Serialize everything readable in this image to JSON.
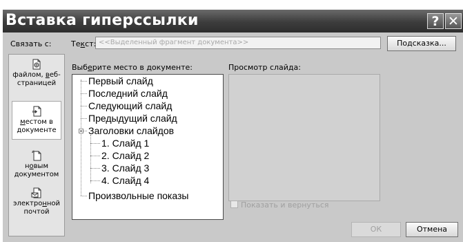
{
  "dialog": {
    "title": "Вставка гиперссылки",
    "help_glyph": "?",
    "close_glyph": "✕",
    "link_to_label": "Связать с:",
    "text_label_prefix": "Те",
    "text_label_accel": "к",
    "text_label_suffix": "ст:",
    "text_value": "<<Выделенный фрагмент документа>>",
    "tooltip_button_prefix": "По",
    "tooltip_button_accel": "д",
    "tooltip_button_suffix": "сказка...",
    "place_label_prefix": "Выб",
    "place_label_accel": "е",
    "place_label_suffix": "рите место в документе:",
    "preview_label": "Просмотр слайда:",
    "show_and_return_label": "Показать и вернуться",
    "ok_label": "ОК",
    "cancel_label": "Отмена"
  },
  "nav": [
    {
      "line1": "файлом, ",
      "accel": "в",
      "line1_rest": "еб-",
      "line2": "страницей",
      "icon": "existing-file-icon",
      "selected": false
    },
    {
      "accel": "м",
      "line1_rest": "естом в",
      "line2": "документе",
      "icon": "place-in-document-icon",
      "selected": true
    },
    {
      "line1": "н",
      "accel": "о",
      "line1_rest": "вым",
      "line2": "документом",
      "icon": "new-document-icon",
      "selected": false
    },
    {
      "line1": "электро",
      "accel": "н",
      "line1_rest": "ной",
      "line2": "почтой",
      "icon": "email-icon",
      "selected": false
    }
  ],
  "tree": {
    "items": [
      "Первый слайд",
      "Последний слайд",
      "Следующий слайд",
      "Предыдущий слайд"
    ],
    "group": "Заголовки слайдов",
    "children": [
      "1. Слайд 1",
      "2. Слайд 2",
      "3. Слайд 3",
      "4. Слайд 4"
    ],
    "last": "Произвольные показы"
  }
}
